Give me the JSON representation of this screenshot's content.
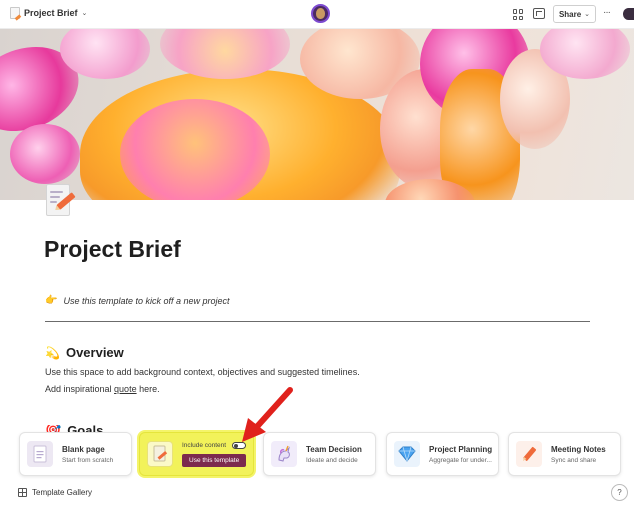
{
  "topbar": {
    "doc_title": "Project Brief",
    "share_label": "Share",
    "more_label": "···"
  },
  "page": {
    "title": "Project Brief",
    "intro_emoji": "👉",
    "intro": "Use this template to kick off a new project",
    "overview_emoji": "💫",
    "overview_heading": "Overview",
    "overview_text": "Use this space to add background context, objectives and suggested timelines.",
    "inspiration_prefix": "Add inspirational ",
    "inspiration_link": "quote",
    "inspiration_suffix": " here.",
    "goals_emoji": "🎯",
    "goals_heading": "Goals"
  },
  "templates": {
    "blank": {
      "title": "Blank page",
      "subtitle": "Start from scratch"
    },
    "current": {
      "toggle_label": "Include content",
      "button_label": "Use this template"
    },
    "team_decision": {
      "title": "Team Decision",
      "subtitle": "Ideate and decide"
    },
    "project_planning": {
      "title": "Project Planning",
      "subtitle": "Aggregate for under..."
    },
    "meeting_notes": {
      "title": "Meeting Notes",
      "subtitle": "Sync and share"
    }
  },
  "footer": {
    "gallery_label": "Template Gallery",
    "help_label": "?"
  },
  "colors": {
    "highlight": "#f2f25a",
    "use_button": "#7c2a4e",
    "arrow": "#e0211c"
  }
}
